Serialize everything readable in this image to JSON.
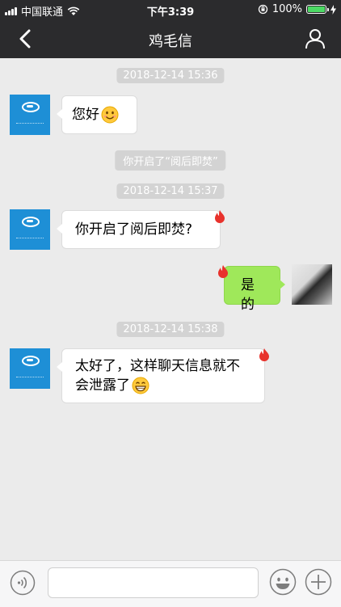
{
  "status_bar": {
    "carrier": "中国联通",
    "time": "下午3:39",
    "battery": "100%"
  },
  "nav": {
    "title": "鸡毛信"
  },
  "messages": {
    "ts1": "2018-12-14 15:36",
    "msg1": "您好",
    "system1": "你开启了“阅后即焚”",
    "ts2": "2018-12-14 15:37",
    "msg2": "你开启了阅后即焚?",
    "msg3": "是的",
    "ts3": "2018-12-14 15:38",
    "msg4_line1": "太好了，这样聊天信息就不",
    "msg4_line2": "会泄露了"
  },
  "icons": {
    "back": "chevron-left-icon",
    "profile": "person-icon",
    "voice": "voice-icon",
    "emoji": "emoji-icon",
    "plus": "plus-icon",
    "flame": "flame-icon"
  },
  "colors": {
    "bar_bg": "#2b2b2d",
    "chat_bg": "#ebebeb",
    "sent_bubble": "#9fe85a",
    "flame": "#e8322c"
  }
}
